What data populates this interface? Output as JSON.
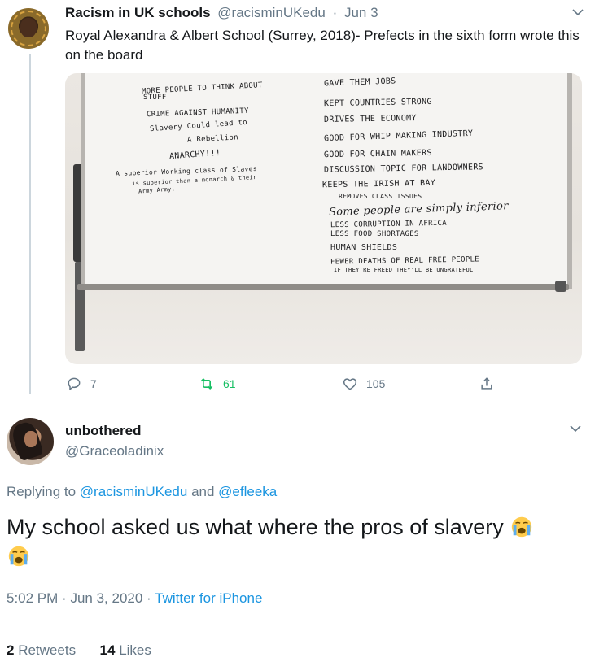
{
  "quoted_tweet": {
    "display_name": "Racism in UK schools",
    "handle": "@racisminUKedu",
    "separator": "·",
    "date": "Jun 3",
    "text": "Royal Alexandra & Albert School (Surrey, 2018)- Prefects in the sixth form wrote this on the board",
    "media": {
      "left_column": [
        "MORE PEOPLE TO THINK ABOUT",
        "STUFF",
        "CRIME AGAINST HUMANITY",
        "Slavery Could lead to",
        "A Rebellion",
        "ANARCHY!!!",
        "A superior Working class of Slaves",
        "is superior than a monarch & their",
        "Army Army."
      ],
      "right_column": [
        "GAVE THEM JOBS",
        "KEPT COUNTRIES STRONG",
        "DRIVES THE ECONOMY",
        "GOOD FOR WHIP MAKING INDUSTRY",
        "GOOD FOR CHAIN MAKERS",
        "DISCUSSION TOPIC FOR LANDOWNERS",
        "KEEPS THE IRISH AT BAY",
        "REMOVES CLASS ISSUES",
        "Some people are simply inferior",
        "LESS CORRUPTION IN AFRICA",
        "LESS FOOD SHORTAGES",
        "HUMAN SHIELDS",
        "FEWER DEATHS OF REAL FREE PEOPLE",
        "IF THEY'RE FREED THEY'LL BE UNGRATEFUL"
      ]
    },
    "actions": {
      "replies": "7",
      "retweets": "61",
      "likes": "105"
    }
  },
  "reply_tweet": {
    "display_name": "unbothered",
    "handle": "@Graceoladinix",
    "replying_prefix": "Replying to",
    "replying_user1": "@racisminUKedu",
    "replying_and": "and",
    "replying_user2": "@efleeka",
    "text": "My school asked us what where the pros of slavery",
    "emoji": "loudly-crying-face",
    "time": "5:02 PM",
    "date": "Jun 3, 2020",
    "meta_separator": "·",
    "source": "Twitter for iPhone",
    "retweet_count": "2",
    "retweet_label": "Retweets",
    "like_count": "14",
    "like_label": "Likes"
  },
  "colors": {
    "text_primary": "#14171a",
    "text_secondary": "#657786",
    "link": "#1b95e0",
    "retweet_green": "#17bf63",
    "divider": "#e6ecf0"
  }
}
